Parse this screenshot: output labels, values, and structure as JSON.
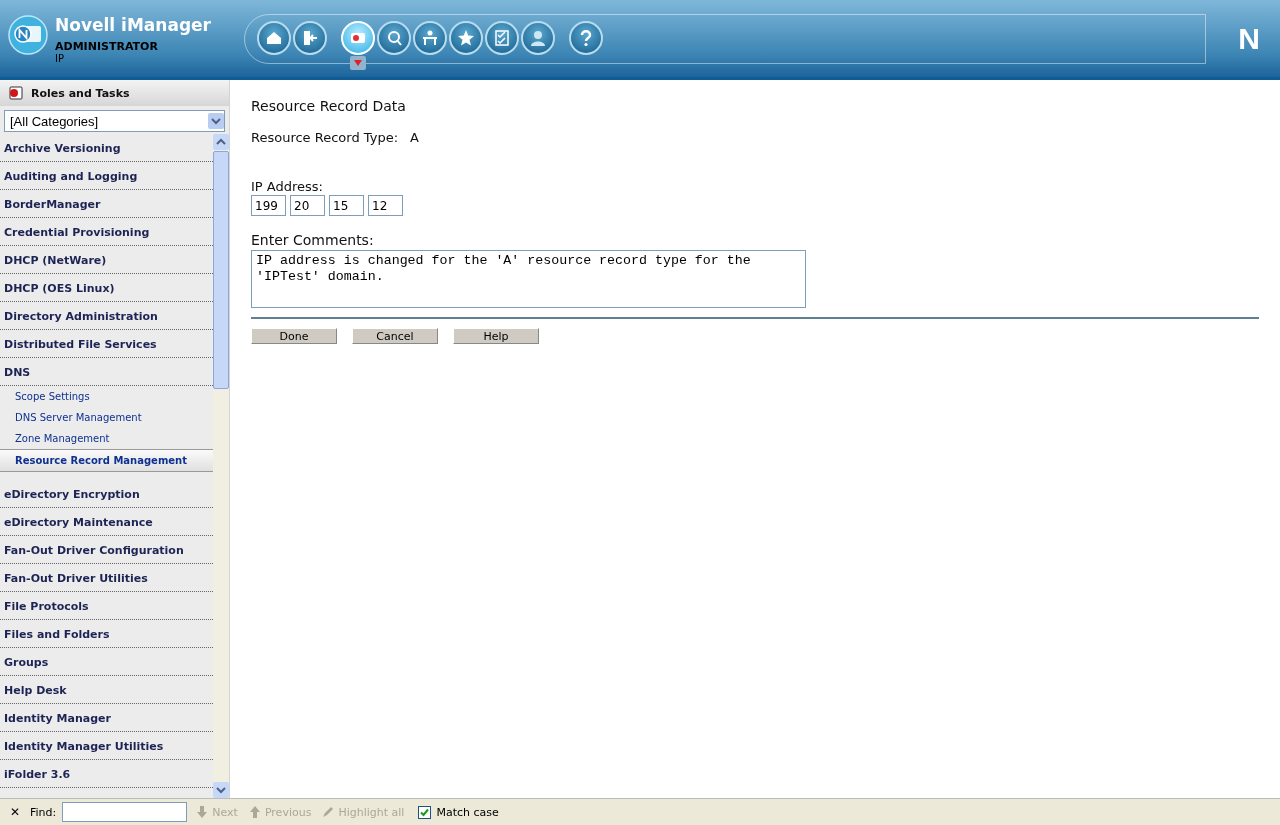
{
  "header": {
    "app_title": "Novell iManager",
    "user": "ADMINISTRATOR",
    "context": "IP",
    "toolbar": [
      {
        "kind": "home",
        "selected": false
      },
      {
        "kind": "exit",
        "selected": false
      },
      {
        "kind": "roles",
        "selected": true
      },
      {
        "kind": "view",
        "selected": false
      },
      {
        "kind": "configure",
        "selected": false
      },
      {
        "kind": "favorites",
        "selected": false
      },
      {
        "kind": "tasks",
        "selected": false
      },
      {
        "kind": "users",
        "selected": false
      },
      {
        "kind": "help",
        "selected": false
      }
    ]
  },
  "sidebar": {
    "title": "Roles and Tasks",
    "category_filter": "[All Categories]",
    "items": [
      {
        "label": "Archive Versioning",
        "selected": false
      },
      {
        "label": "Auditing and Logging",
        "selected": false
      },
      {
        "label": "BorderManager",
        "selected": false
      },
      {
        "label": "Credential Provisioning",
        "selected": false
      },
      {
        "label": "DHCP (NetWare)",
        "selected": false
      },
      {
        "label": "DHCP (OES Linux)",
        "selected": false
      },
      {
        "label": "Directory Administration",
        "selected": false
      },
      {
        "label": "Distributed File Services",
        "selected": false
      },
      {
        "label": "DNS",
        "selected": false,
        "children": [
          {
            "label": "Scope Settings",
            "selected": false
          },
          {
            "label": "DNS Server Management",
            "selected": false
          },
          {
            "label": "Zone Management",
            "selected": false
          },
          {
            "label": "Resource Record Management",
            "selected": true
          }
        ]
      },
      {
        "label": "eDirectory Encryption",
        "selected": false
      },
      {
        "label": "eDirectory Maintenance",
        "selected": false
      },
      {
        "label": "Fan-Out Driver Configuration",
        "selected": false
      },
      {
        "label": "Fan-Out Driver Utilities",
        "selected": false
      },
      {
        "label": "File Protocols",
        "selected": false
      },
      {
        "label": "Files and Folders",
        "selected": false
      },
      {
        "label": "Groups",
        "selected": false
      },
      {
        "label": "Help Desk",
        "selected": false
      },
      {
        "label": "Identity Manager",
        "selected": false
      },
      {
        "label": "Identity Manager Utilities",
        "selected": false
      },
      {
        "label": "iFolder 3.6",
        "selected": false
      }
    ]
  },
  "content": {
    "heading": "Resource Record Data",
    "record_type_label": "Resource Record Type:",
    "record_type": "A",
    "ip_label": "IP Address:",
    "ip_octets": [
      "199",
      "20",
      "15",
      "12"
    ],
    "comments_label": "Enter Comments:",
    "comments": "IP address is changed for the 'A' resource record type for the 'IPTest' domain.",
    "buttons": [
      "Done",
      "Cancel",
      "Help"
    ]
  },
  "brand_mark": "N",
  "find_bar": {
    "close": "✕",
    "label": "Find:",
    "next": "Next",
    "previous": "Previous",
    "highlight_all": "Highlight all",
    "navigation_disabled": true,
    "match_case": "Match case",
    "match_case_checked": true
  }
}
